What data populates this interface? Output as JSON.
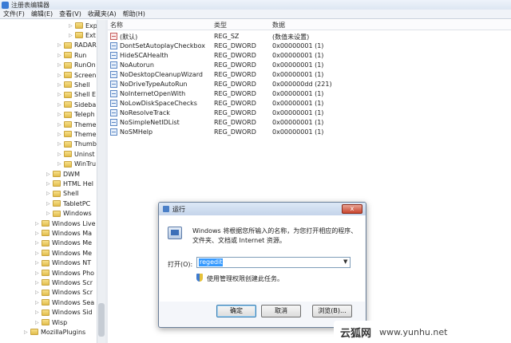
{
  "window": {
    "title": "注册表编辑器",
    "menu": [
      "文件(F)",
      "编辑(E)",
      "查看(V)",
      "收藏夹(A)",
      "帮助(H)"
    ]
  },
  "tree": {
    "items": [
      {
        "label": "Exp",
        "indent": 6
      },
      {
        "label": "Ext",
        "indent": 6
      },
      {
        "label": "RADAR",
        "indent": 5
      },
      {
        "label": "Run",
        "indent": 5
      },
      {
        "label": "RunOn",
        "indent": 5
      },
      {
        "label": "Screen",
        "indent": 5
      },
      {
        "label": "Shell",
        "indent": 5
      },
      {
        "label": "Shell E",
        "indent": 5
      },
      {
        "label": "Sideba",
        "indent": 5
      },
      {
        "label": "Teleph",
        "indent": 5
      },
      {
        "label": "Theme",
        "indent": 5
      },
      {
        "label": "Theme",
        "indent": 5
      },
      {
        "label": "Thumb",
        "indent": 5
      },
      {
        "label": "Uninst",
        "indent": 5
      },
      {
        "label": "WinTru",
        "indent": 5
      },
      {
        "label": "DWM",
        "indent": 4
      },
      {
        "label": "HTML Hel",
        "indent": 4
      },
      {
        "label": "Shell",
        "indent": 4
      },
      {
        "label": "TabletPC",
        "indent": 4
      },
      {
        "label": "Windows",
        "indent": 4
      },
      {
        "label": "Windows Live",
        "indent": 3
      },
      {
        "label": "Windows Ma",
        "indent": 3
      },
      {
        "label": "Windows Me",
        "indent": 3
      },
      {
        "label": "Windows Me",
        "indent": 3
      },
      {
        "label": "Windows NT",
        "indent": 3
      },
      {
        "label": "Windows Pho",
        "indent": 3
      },
      {
        "label": "Windows Scr",
        "indent": 3
      },
      {
        "label": "Windows Scr",
        "indent": 3
      },
      {
        "label": "Windows Sea",
        "indent": 3
      },
      {
        "label": "Windows Sid",
        "indent": 3
      },
      {
        "label": "Wisp",
        "indent": 3
      },
      {
        "label": "MozillaPlugins",
        "indent": 2
      }
    ]
  },
  "list": {
    "headers": {
      "name": "名称",
      "type": "类型",
      "data": "数据"
    },
    "rows": [
      {
        "name": "(默认)",
        "type": "REG_SZ",
        "data": "(数值未设置)",
        "icon": "string-value-icon"
      },
      {
        "name": "DontSetAutoplayCheckbox",
        "type": "REG_DWORD",
        "data": "0x00000001 (1)",
        "icon": "dword-value-icon"
      },
      {
        "name": "HideSCAHealth",
        "type": "REG_DWORD",
        "data": "0x00000001 (1)",
        "icon": "dword-value-icon"
      },
      {
        "name": "NoAutorun",
        "type": "REG_DWORD",
        "data": "0x00000001 (1)",
        "icon": "dword-value-icon"
      },
      {
        "name": "NoDesktopCleanupWizard",
        "type": "REG_DWORD",
        "data": "0x00000001 (1)",
        "icon": "dword-value-icon"
      },
      {
        "name": "NoDriveTypeAutoRun",
        "type": "REG_DWORD",
        "data": "0x000000dd (221)",
        "icon": "dword-value-icon"
      },
      {
        "name": "NoInternetOpenWith",
        "type": "REG_DWORD",
        "data": "0x00000001 (1)",
        "icon": "dword-value-icon"
      },
      {
        "name": "NoLowDiskSpaceChecks",
        "type": "REG_DWORD",
        "data": "0x00000001 (1)",
        "icon": "dword-value-icon"
      },
      {
        "name": "NoResolveTrack",
        "type": "REG_DWORD",
        "data": "0x00000001 (1)",
        "icon": "dword-value-icon"
      },
      {
        "name": "NoSimpleNetIDList",
        "type": "REG_DWORD",
        "data": "0x00000001 (1)",
        "icon": "dword-value-icon"
      },
      {
        "name": "NoSMHelp",
        "type": "REG_DWORD",
        "data": "0x00000001 (1)",
        "icon": "dword-value-icon"
      }
    ]
  },
  "run_dialog": {
    "title": "运行",
    "close_label": "x",
    "description": "Windows 将根据您所输入的名称，为您打开相应的程序、文件夹、文档或 Internet 资源。",
    "open_label": "打开(O):",
    "open_value": "regedit",
    "admin_text": "使用管理权限创建此任务。",
    "ok_label": "确定",
    "cancel_label": "取消",
    "browse_label": "浏览(B)..."
  },
  "watermark": {
    "brand": "云狐网",
    "url": "www.yunhu.net"
  }
}
